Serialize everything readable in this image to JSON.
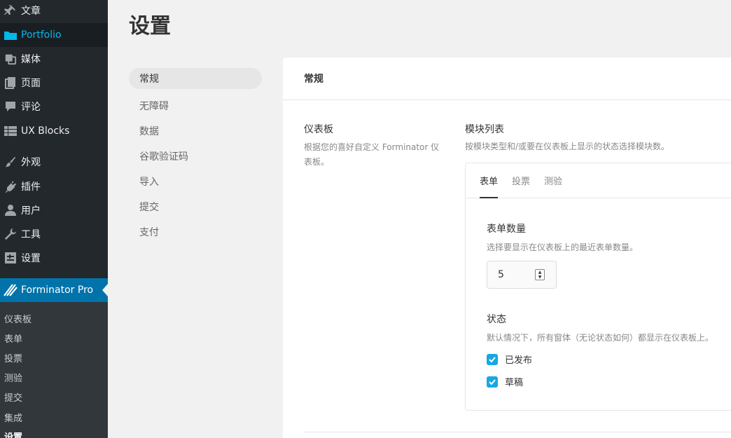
{
  "wp_menu": {
    "items": [
      {
        "label": "文章",
        "icon": "pin-icon"
      },
      {
        "label": "Portfolio",
        "icon": "folder-icon"
      },
      {
        "label": "媒体",
        "icon": "media-icon"
      },
      {
        "label": "页面",
        "icon": "page-icon"
      },
      {
        "label": "评论",
        "icon": "comment-icon"
      },
      {
        "label": "UX Blocks",
        "icon": "grid-icon"
      },
      {
        "label": "外观",
        "icon": "brush-icon"
      },
      {
        "label": "插件",
        "icon": "plugin-icon"
      },
      {
        "label": "用户",
        "icon": "user-icon"
      },
      {
        "label": "工具",
        "icon": "wrench-icon"
      },
      {
        "label": "设置",
        "icon": "settings-icon"
      },
      {
        "label": "Forminator Pro",
        "icon": "forminator-icon"
      }
    ],
    "submenu": [
      "仪表板",
      "表单",
      "投票",
      "测验",
      "提交",
      "集成",
      "设置"
    ]
  },
  "page": {
    "title": "设置"
  },
  "side_nav": [
    "常规",
    "无障碍",
    "数据",
    "谷歌验证码",
    "导入",
    "提交",
    "支付"
  ],
  "box": {
    "title": "常规",
    "label_title": "仪表板",
    "label_desc": "根据您的喜好自定义 Forminator 仪表板。",
    "field_title": "模块列表",
    "field_desc": "按模块类型和/或要在仪表板上显示的状态选择模块数。",
    "tabs": [
      "表单",
      "投票",
      "测验"
    ],
    "count_title": "表单数量",
    "count_desc": "选择要显示在仪表板上的最近表单数量。",
    "count_value": "5",
    "status_title": "状态",
    "status_desc": "默认情况下，所有窗体（无论状态如何）都显示在仪表板上。",
    "checkboxes": [
      {
        "label": "已发布",
        "checked": true
      },
      {
        "label": "草稿",
        "checked": true
      }
    ]
  },
  "colors": {
    "sidebar_bg": "#23282d",
    "active_menu": "#0073aa",
    "portfolio_text": "#00b9eb",
    "checkbox": "#17a8e3"
  }
}
